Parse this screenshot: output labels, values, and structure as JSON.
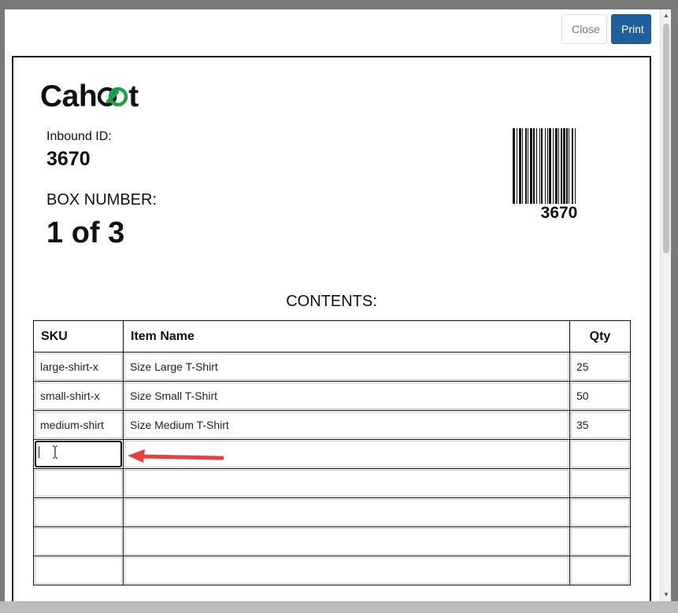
{
  "modal": {
    "close_label": "Close",
    "print_label": "Print",
    "print_color": "#1f5f9c"
  },
  "label": {
    "logo_text": "Cahoot",
    "logo_icon": "chain-link-icon",
    "logo_accent": "#1aa14b",
    "inbound_label": "Inbound ID:",
    "inbound_id": "3670",
    "box_label": "BOX NUMBER:",
    "box_number": "1 of 3",
    "barcode_value": "3670",
    "contents_title": "CONTENTS:"
  },
  "table": {
    "headers": {
      "sku": "SKU",
      "item_name": "Item Name",
      "qty": "Qty"
    },
    "rows": [
      {
        "sku": "large-shirt-x",
        "item_name": "Size Large T-Shirt",
        "qty": "25"
      },
      {
        "sku": "small-shirt-x",
        "item_name": "Size Small T-Shirt",
        "qty": "50"
      },
      {
        "sku": "medium-shirt",
        "item_name": "Size Medium T-Shirt",
        "qty": "35"
      },
      {
        "sku": "",
        "item_name": "",
        "qty": ""
      },
      {
        "sku": "",
        "item_name": "",
        "qty": ""
      },
      {
        "sku": "",
        "item_name": "",
        "qty": ""
      },
      {
        "sku": "",
        "item_name": "",
        "qty": ""
      },
      {
        "sku": "",
        "item_name": "",
        "qty": ""
      }
    ]
  },
  "annotation": {
    "arrow_color": "#e84040",
    "cursor_icon": "i-beam-cursor-icon"
  }
}
